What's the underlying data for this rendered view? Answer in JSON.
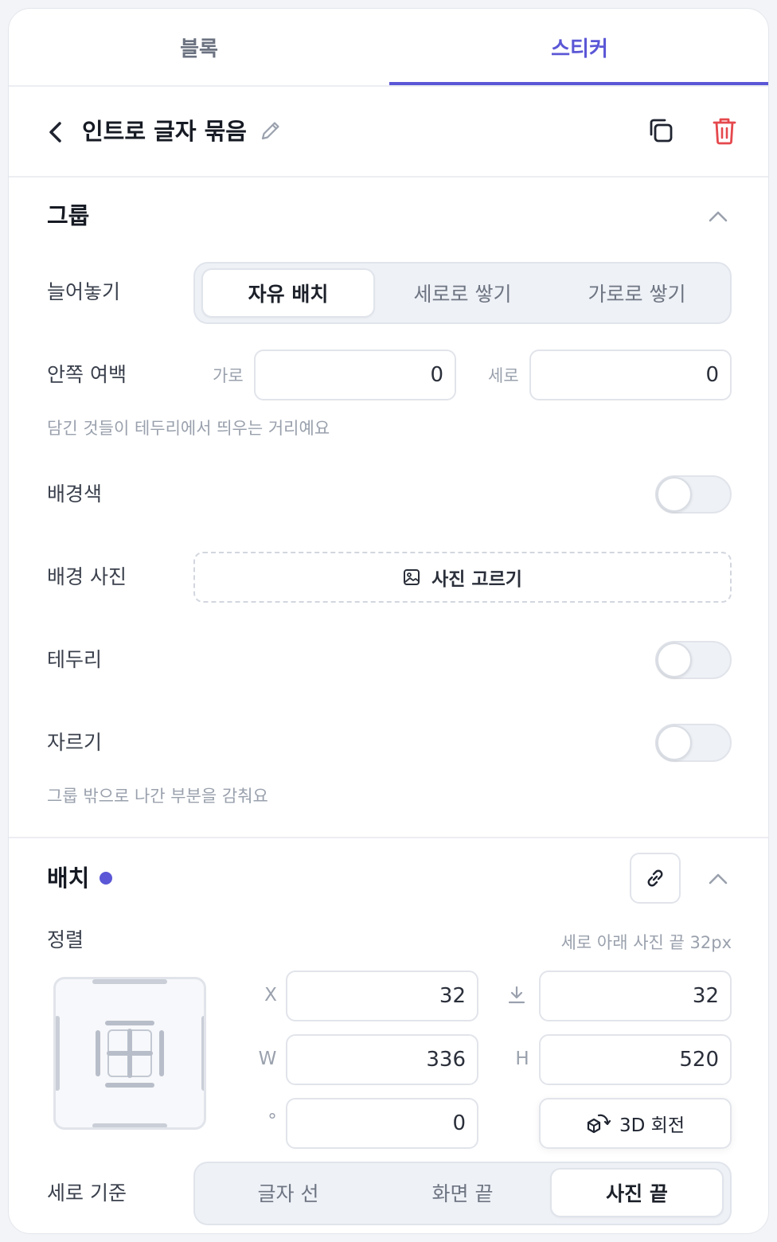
{
  "tabs": [
    {
      "label": "블록",
      "active": false
    },
    {
      "label": "스티커",
      "active": true
    }
  ],
  "accent_color": "#5b57d6",
  "danger_color": "#e5484d",
  "header": {
    "title": "인트로 글자 묶음"
  },
  "group": {
    "title": "그룹",
    "arrange": {
      "label": "늘어놓기",
      "options": [
        "자유 배치",
        "세로로 쌓기",
        "가로로 쌓기"
      ],
      "selected": "자유 배치"
    },
    "padding": {
      "label": "안쪽 여백",
      "horizontal_label": "가로",
      "horizontal_value": "0",
      "vertical_label": "세로",
      "vertical_value": "0",
      "hint": "담긴 것들이 테두리에서 띄우는 거리예요"
    },
    "background_color": {
      "label": "배경색",
      "enabled": false
    },
    "background_photo": {
      "label": "배경 사진",
      "button": "사진 고르기"
    },
    "border": {
      "label": "테두리",
      "enabled": false
    },
    "clip": {
      "label": "자르기",
      "enabled": false,
      "hint": "그룹 밖으로 나간 부분을 감춰요"
    }
  },
  "placement": {
    "title": "배치",
    "align": {
      "label": "정렬",
      "summary": "세로 아래 사진 끝 32px"
    },
    "fields": {
      "x_label": "X",
      "x_value": "32",
      "bottom_value": "32",
      "w_label": "W",
      "w_value": "336",
      "h_label": "H",
      "h_value": "520",
      "rotation_label": "°",
      "rotation_value": "0"
    },
    "rotate3d_label": "3D 회전",
    "vertical_ref": {
      "label": "세로 기준",
      "options": [
        "글자 선",
        "화면 끝",
        "사진 끝"
      ],
      "selected": "사진 끝"
    }
  }
}
